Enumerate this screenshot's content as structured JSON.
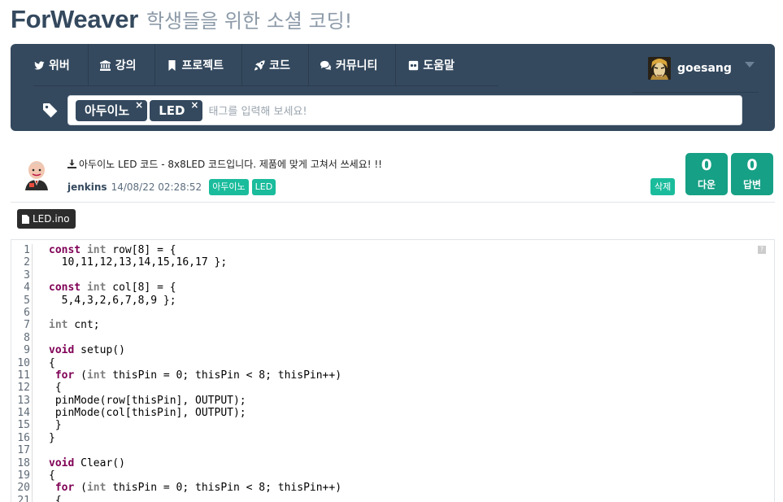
{
  "brand": {
    "name": "ForWeaver",
    "tagline": "학생들을 위한 소셜 코딩!"
  },
  "nav": {
    "items": [
      {
        "label": "위버",
        "icon": "twitter-bird-icon"
      },
      {
        "label": "강의",
        "icon": "institution-icon"
      },
      {
        "label": "프로젝트",
        "icon": "bookmark-icon"
      },
      {
        "label": "코드",
        "icon": "rocket-icon"
      },
      {
        "label": "커뮤니티",
        "icon": "comments-icon"
      },
      {
        "label": "도움말",
        "icon": "flickr-icon"
      }
    ],
    "user": {
      "name": "goesang",
      "icon": "caret-down-icon"
    }
  },
  "tag_filter": {
    "icon": "tag-icon",
    "tags": [
      "아두이노",
      "LED"
    ],
    "remove_symbol": "×",
    "placeholder": "태그를 입력해 보세요!"
  },
  "post": {
    "title": "아두이노 LED 코드 - 8x8LED 코드입니다. 제품에 맞게 고쳐서 쓰세요! !!",
    "author": "jenkins",
    "date": "14/08/22 02:28:52",
    "badges": [
      "아두이노",
      "LED"
    ],
    "delete_label": "삭제",
    "downloads": {
      "count": "0",
      "label": "다운"
    },
    "replies": {
      "count": "0",
      "label": "답변"
    }
  },
  "file": {
    "name": "LED.ino"
  },
  "code": {
    "help_label": "?",
    "lines": [
      [
        [
          "kw",
          "const"
        ],
        [
          "src",
          " "
        ],
        [
          "ty",
          "int"
        ],
        [
          "src",
          " row[8] = {"
        ]
      ],
      [
        [
          "src",
          "  10,11,12,13,14,15,16,17 };"
        ]
      ],
      [
        [
          "src",
          ""
        ]
      ],
      [
        [
          "kw",
          "const"
        ],
        [
          "src",
          " "
        ],
        [
          "ty",
          "int"
        ],
        [
          "src",
          " col[8] = {"
        ]
      ],
      [
        [
          "src",
          "  5,4,3,2,6,7,8,9 };"
        ]
      ],
      [
        [
          "src",
          ""
        ]
      ],
      [
        [
          "ty",
          "int"
        ],
        [
          "src",
          " cnt;"
        ]
      ],
      [
        [
          "src",
          ""
        ]
      ],
      [
        [
          "kw",
          "void"
        ],
        [
          "src",
          " setup()"
        ]
      ],
      [
        [
          "src",
          "{"
        ]
      ],
      [
        [
          "src",
          " "
        ],
        [
          "kw",
          "for"
        ],
        [
          "src",
          " ("
        ],
        [
          "ty",
          "int"
        ],
        [
          "src",
          " thisPin = 0; thisPin < 8; thisPin++)"
        ]
      ],
      [
        [
          "src",
          " {"
        ]
      ],
      [
        [
          "src",
          " pinMode(row[thisPin], OUTPUT);"
        ]
      ],
      [
        [
          "src",
          " pinMode(col[thisPin], OUTPUT);"
        ]
      ],
      [
        [
          "src",
          " }"
        ]
      ],
      [
        [
          "src",
          "}"
        ]
      ],
      [
        [
          "src",
          ""
        ]
      ],
      [
        [
          "kw",
          "void"
        ],
        [
          "src",
          " Clear()"
        ]
      ],
      [
        [
          "src",
          "{"
        ]
      ],
      [
        [
          "src",
          " "
        ],
        [
          "kw",
          "for"
        ],
        [
          "src",
          " ("
        ],
        [
          "ty",
          "int"
        ],
        [
          "src",
          " thisPin = 0; thisPin < 8; thisPin++)"
        ]
      ],
      [
        [
          "src",
          " {"
        ]
      ]
    ]
  }
}
